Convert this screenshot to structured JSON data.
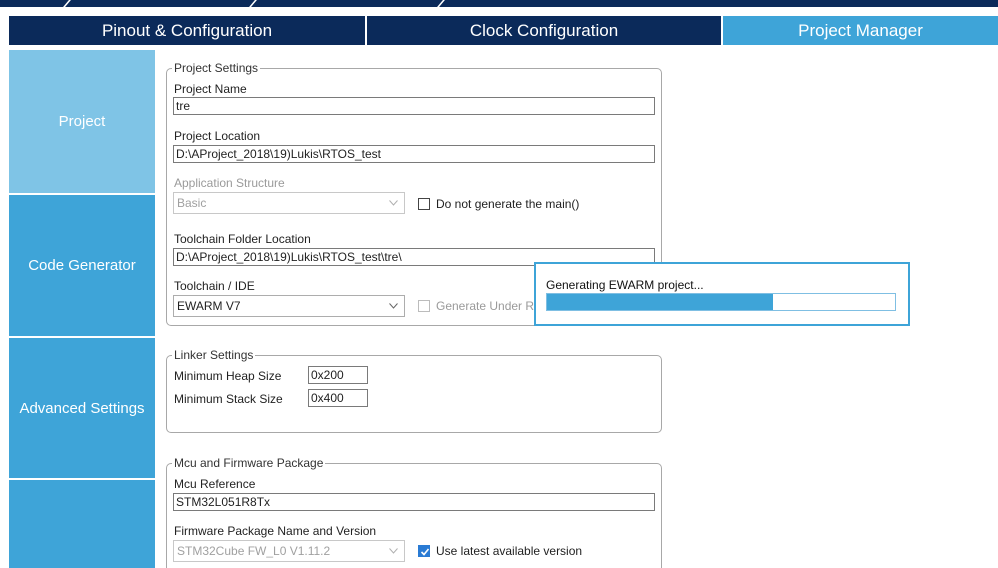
{
  "tabs": [
    {
      "label": "Pinout & Configuration"
    },
    {
      "label": "Clock Configuration"
    },
    {
      "label": "Project Manager"
    }
  ],
  "sidebar": {
    "items": [
      {
        "label": "Project"
      },
      {
        "label": "Code Generator"
      },
      {
        "label": "Advanced Settings"
      }
    ]
  },
  "project_settings": {
    "title": "Project Settings",
    "name_label": "Project Name",
    "name_value": "tre",
    "location_label": "Project Location",
    "location_value": "D:\\AProject_2018\\19)Lukis\\RTOS_test",
    "app_structure_label": "Application Structure",
    "app_structure_value": "Basic",
    "no_main_label": "Do not generate the main()",
    "toolchain_folder_label": "Toolchain Folder Location",
    "toolchain_folder_value": "D:\\AProject_2018\\19)Lukis\\RTOS_test\\tre\\",
    "toolchain_ide_label": "Toolchain / IDE",
    "toolchain_ide_value": "EWARM V7",
    "generate_under_root_label": "Generate Under Ro"
  },
  "linker_settings": {
    "title": "Linker Settings",
    "heap_label": "Minimum Heap Size",
    "heap_value": "0x200",
    "stack_label": "Minimum Stack Size",
    "stack_value": "0x400"
  },
  "mcu_firmware": {
    "title": "Mcu and Firmware Package",
    "mcu_ref_label": "Mcu Reference",
    "mcu_ref_value": "STM32L051R8Tx",
    "fw_label": "Firmware Package Name and Version",
    "fw_value": "STM32Cube FW_L0 V1.11.2",
    "use_latest_label": "Use latest available version"
  },
  "progress_dialog": {
    "message": "Generating EWARM project...",
    "progress_percent": 65
  },
  "colors": {
    "dark_navy": "#0b2a5a",
    "accent_blue": "#3ea4d8",
    "sidebar_selected": "#7fc4e6"
  }
}
